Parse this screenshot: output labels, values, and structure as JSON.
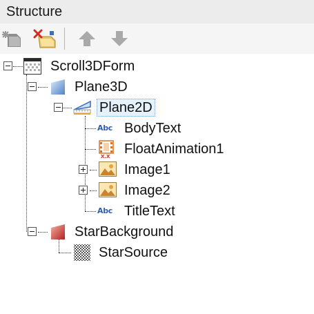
{
  "panel": {
    "title": "Structure"
  },
  "toolbar": {
    "buttons": [
      {
        "name": "add-object",
        "icon": "add-object-icon"
      },
      {
        "name": "delete",
        "icon": "delete-icon"
      },
      {
        "name": "move-up",
        "icon": "arrow-up-icon"
      },
      {
        "name": "move-down",
        "icon": "arrow-down-icon"
      }
    ]
  },
  "tree": {
    "nodes": [
      {
        "label": "Scroll3DForm",
        "icon": "form-icon",
        "expanded": true
      },
      {
        "label": "Plane3D",
        "icon": "plane3d-icon",
        "expanded": true
      },
      {
        "label": "Plane2D",
        "icon": "plane2d-icon",
        "expanded": true,
        "selected": true
      },
      {
        "label": "BodyText",
        "icon": "text-abc-icon"
      },
      {
        "label": "FloatAnimation1",
        "icon": "animation-icon"
      },
      {
        "label": "Image1",
        "icon": "image-icon",
        "expanded": false
      },
      {
        "label": "Image2",
        "icon": "image-icon",
        "expanded": false
      },
      {
        "label": "TitleText",
        "icon": "text-abc-icon"
      },
      {
        "label": "StarBackground",
        "icon": "star-background-icon",
        "expanded": true
      },
      {
        "label": "StarSource",
        "icon": "checker-source-icon"
      }
    ],
    "abc_glyph": "Abc"
  },
  "colors": {
    "selection": "#e5f1fb",
    "text_icon": "#2f5fa8",
    "arrow_disabled": "#a9a9a9"
  }
}
